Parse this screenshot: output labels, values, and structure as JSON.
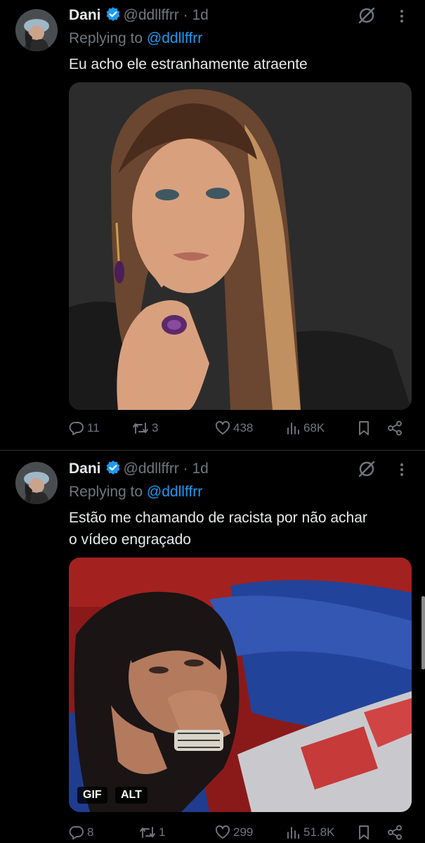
{
  "tweets": [
    {
      "name": "Dani",
      "handle": "@ddllffrr",
      "time": "· 1d",
      "replying_prefix": "Replying to",
      "replying_to": "@ddllffrr",
      "text": "Eu acho ele estranhamente atraente",
      "stats": {
        "replies": "11",
        "retweets": "3",
        "likes": "438",
        "views": "68K"
      }
    },
    {
      "name": "Dani",
      "handle": "@ddllffrr",
      "time": "· 1d",
      "replying_prefix": "Replying to",
      "replying_to": "@ddllffrr",
      "text_line1": "Estão me chamando de racista por não achar",
      "text_line2": "o vídeo engraçado",
      "media_badges": {
        "gif": "GIF",
        "alt": "ALT"
      },
      "stats": {
        "replies": "8",
        "retweets": "1",
        "likes": "299",
        "views": "51.8K"
      }
    }
  ],
  "colors": {
    "accent": "#1d9bf0",
    "muted": "#71767b",
    "text": "#e7e9ea",
    "background": "#000000",
    "divider": "#2f3336"
  },
  "icons": [
    "verified-badge-icon",
    "grok-icon",
    "more-icon",
    "reply-icon",
    "retweet-icon",
    "like-icon",
    "views-icon",
    "bookmark-icon",
    "share-icon"
  ]
}
